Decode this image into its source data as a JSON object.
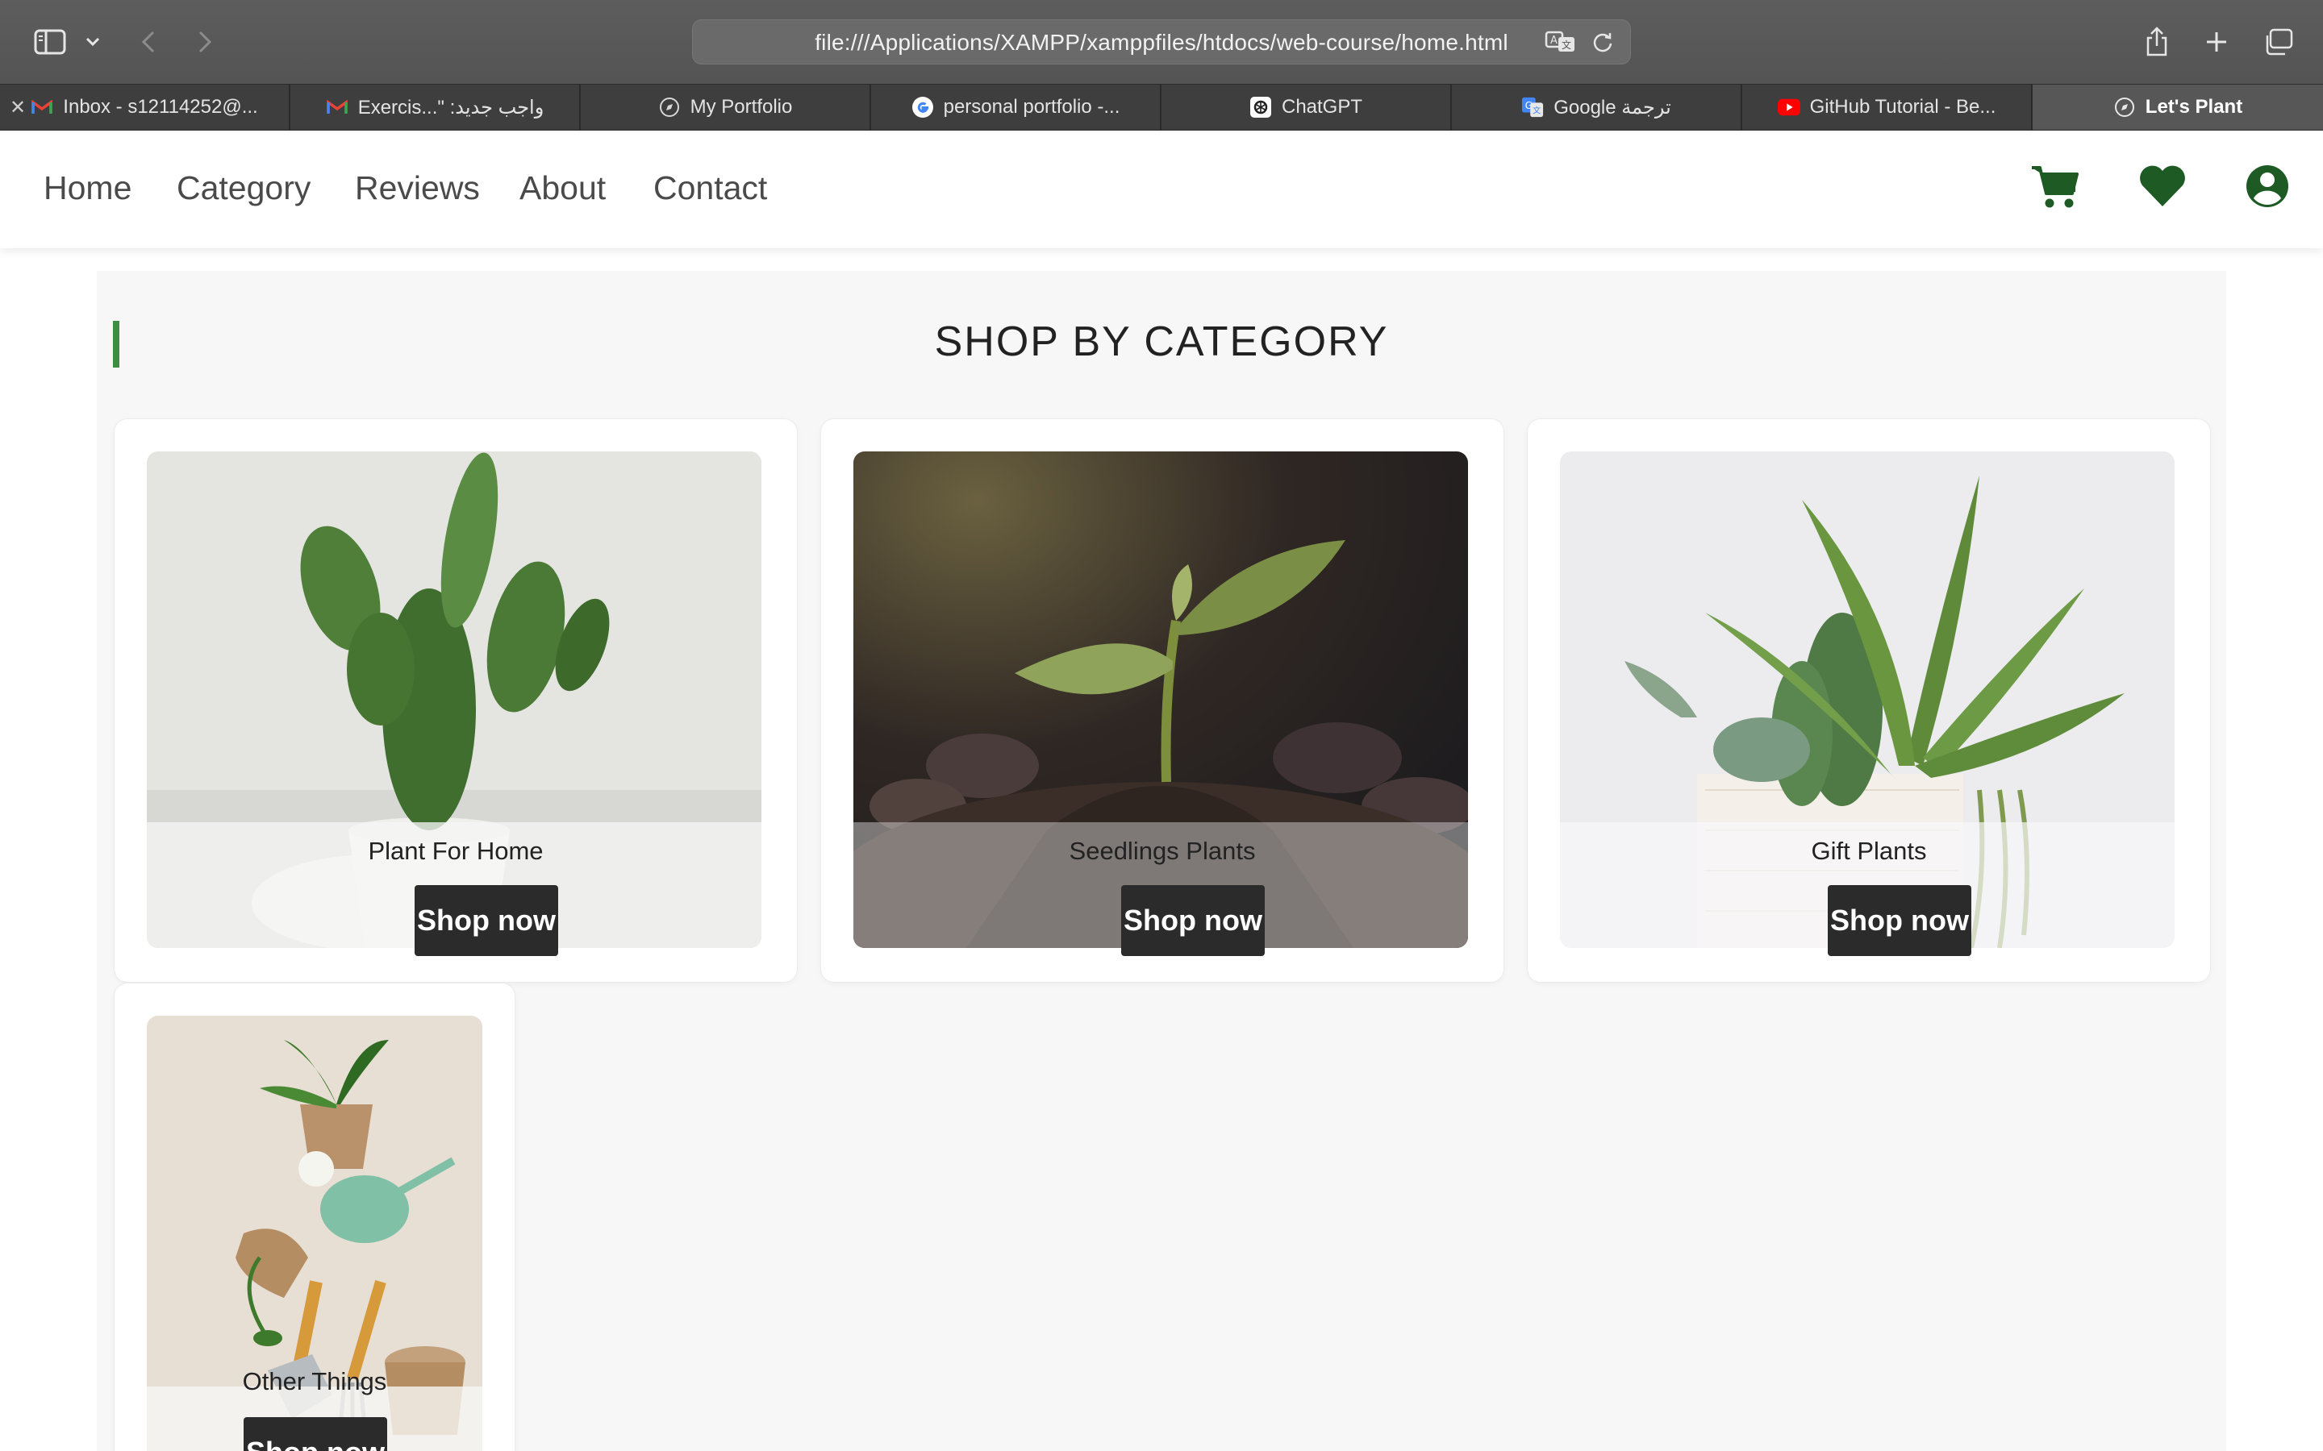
{
  "browser": {
    "url": "file:///Applications/XAMPP/xamppfiles/htdocs/web-course/home.html",
    "tabs": [
      {
        "label": "Inbox - s12114252@...",
        "icon": "gmail-icon"
      },
      {
        "label": "Exercis...\" :واجب جديد",
        "icon": "gmail-icon"
      },
      {
        "label": "My Portfolio",
        "icon": "compass-icon"
      },
      {
        "label": "personal portfolio -...",
        "icon": "google-icon"
      },
      {
        "label": "ChatGPT",
        "icon": "chatgpt-icon"
      },
      {
        "label": "Google ترجمة",
        "icon": "google-translate-icon"
      },
      {
        "label": "GitHub Tutorial - Be...",
        "icon": "youtube-icon"
      },
      {
        "label": "Let's Plant",
        "icon": "compass-icon",
        "active": true
      }
    ]
  },
  "nav": {
    "items": [
      "Home",
      "Category",
      "Reviews",
      "About",
      "Contact"
    ],
    "icons": [
      "cart-icon",
      "heart-icon",
      "user-circle-icon"
    ],
    "icon_color": "#1e5a24"
  },
  "section": {
    "title": "SHOP BY CATEGORY",
    "accent_color": "#3e8e41"
  },
  "categories": [
    {
      "label": "Plant For Home",
      "button": "Shop now",
      "image": "cactus-photo"
    },
    {
      "label": "Seedlings Plants",
      "button": "Shop now",
      "image": "seedling-photo"
    },
    {
      "label": "Gift Plants",
      "button": "Shop now",
      "image": "succulents-photo"
    },
    {
      "label": "Other Things",
      "button": "Shop now",
      "image": "gardening-tools-photo"
    }
  ]
}
